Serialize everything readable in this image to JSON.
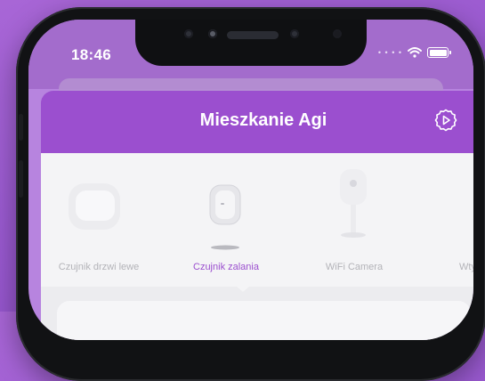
{
  "status_bar": {
    "time": "18:46"
  },
  "header": {
    "title": "Mieszkanie Agi"
  },
  "devices": [
    {
      "label": "Czujnik drzwi lewe",
      "icon": "door-sensor-icon",
      "active": false
    },
    {
      "label": "Czujnik zalania",
      "icon": "flood-sensor-icon",
      "active": true
    },
    {
      "label": "WiFi Camera",
      "icon": "wifi-camera-icon",
      "active": false
    },
    {
      "label": "Wtyc",
      "icon": "smart-plug-icon",
      "active": false
    }
  ],
  "colors": {
    "accent": "#9b4fcf",
    "background": "#9a5ad0",
    "inactive_label": "#b3b3b8"
  }
}
